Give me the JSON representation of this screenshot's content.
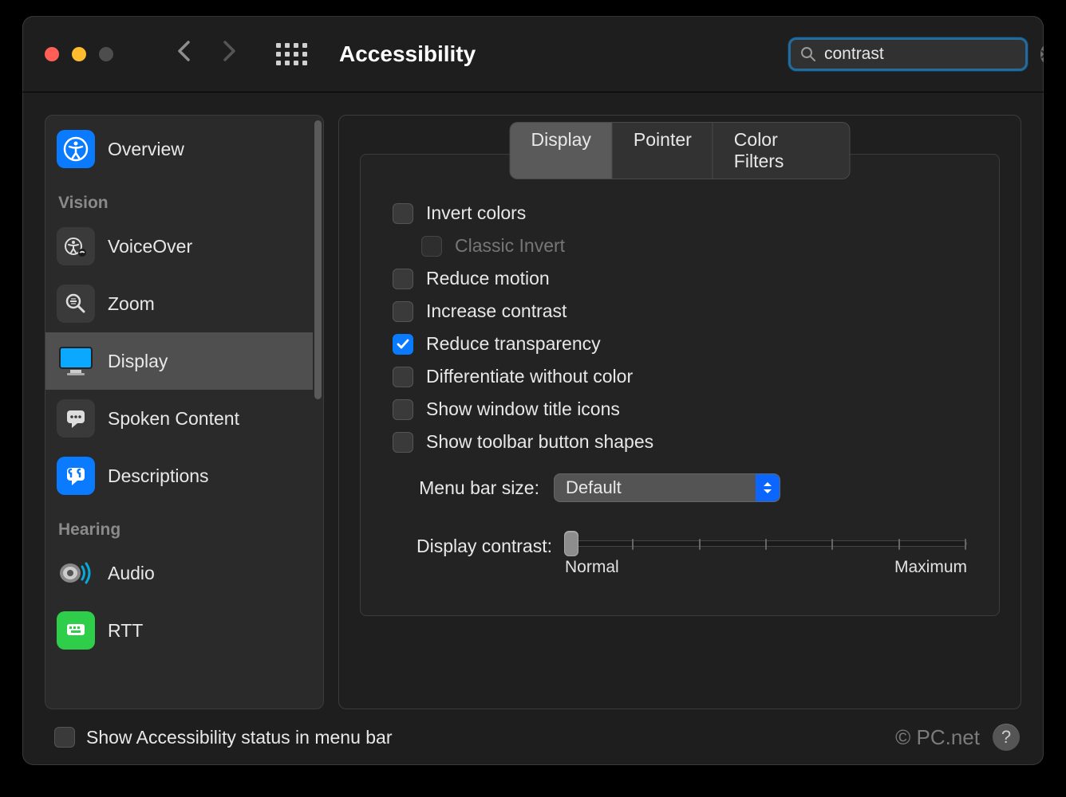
{
  "window": {
    "title": "Accessibility"
  },
  "search": {
    "value": "contrast"
  },
  "sidebar": {
    "overview": "Overview",
    "sections": [
      {
        "title": "Vision",
        "items": [
          {
            "id": "voiceover",
            "label": "VoiceOver"
          },
          {
            "id": "zoom",
            "label": "Zoom"
          },
          {
            "id": "display",
            "label": "Display",
            "selected": true
          },
          {
            "id": "spoken",
            "label": "Spoken Content"
          },
          {
            "id": "descriptions",
            "label": "Descriptions"
          }
        ]
      },
      {
        "title": "Hearing",
        "items": [
          {
            "id": "audio",
            "label": "Audio"
          },
          {
            "id": "rtt",
            "label": "RTT"
          }
        ]
      }
    ]
  },
  "tabs": {
    "display": "Display",
    "pointer": "Pointer",
    "color_filters": "Color Filters"
  },
  "options": {
    "invert_colors": "Invert colors",
    "classic_invert": "Classic Invert",
    "reduce_motion": "Reduce motion",
    "increase_contrast": "Increase contrast",
    "reduce_transparency": "Reduce transparency",
    "differentiate": "Differentiate without color",
    "window_title_icons": "Show window title icons",
    "toolbar_shapes": "Show toolbar button shapes"
  },
  "menu_bar": {
    "label": "Menu bar size:",
    "value": "Default"
  },
  "contrast": {
    "label": "Display contrast:",
    "min_label": "Normal",
    "max_label": "Maximum"
  },
  "footer": {
    "status_label": "Show Accessibility status in menu bar",
    "watermark": "© PC.net"
  }
}
